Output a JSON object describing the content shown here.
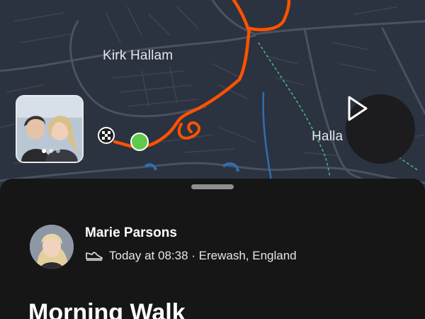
{
  "map": {
    "labels": [
      "Kirk Hallam",
      "Halla"
    ]
  },
  "photo": {
    "dots": 3,
    "active_dot": 0
  },
  "activity": {
    "athlete_name": "Marie Parsons",
    "type_icon": "shoe-icon",
    "meta": "Today at 08:38 · Erewash, England",
    "title": "Morning Walk"
  },
  "colors": {
    "route": "#fc5200",
    "start": "#5ec94b",
    "map_bg": "#2b3240",
    "sheet_bg": "#161616"
  }
}
